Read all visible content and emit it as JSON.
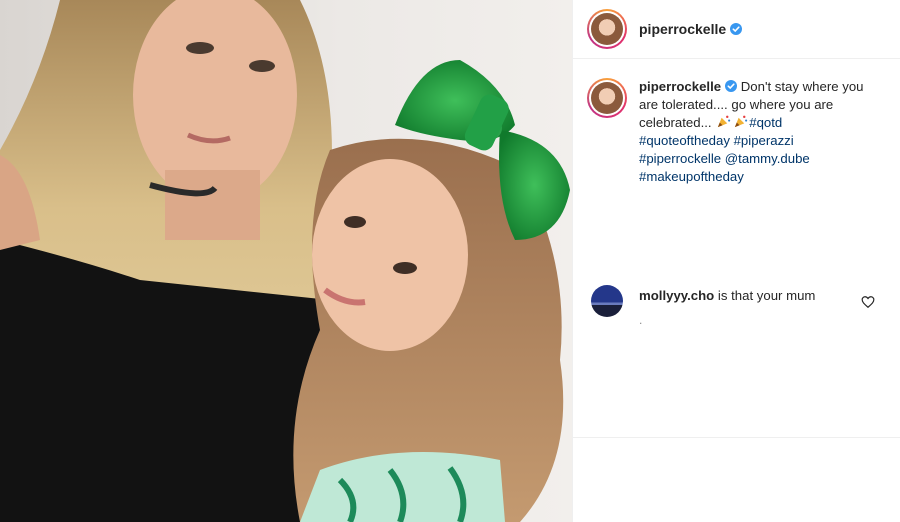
{
  "post": {
    "username": "piperrockelle",
    "verified": true
  },
  "caption": {
    "username": "piperrockelle",
    "text_1": "Don't stay where you are tolerated.... go where you are celebrated...",
    "hashtags_1": "#qotd",
    "hashtags_2": "#quoteoftheday #piperazzi",
    "hashtags_3": "#piperrockelle",
    "mention": "@tammy.dube",
    "hashtags_4": "#makeupoftheday",
    "emoji": "party-popper-icon"
  },
  "comments": [
    {
      "username": "mollyyy.cho",
      "text": "is that your mum",
      "meta": "."
    }
  ],
  "colors": {
    "link": "#003569",
    "text": "#262626",
    "verified": "#3897f0",
    "border": "#efefef"
  }
}
